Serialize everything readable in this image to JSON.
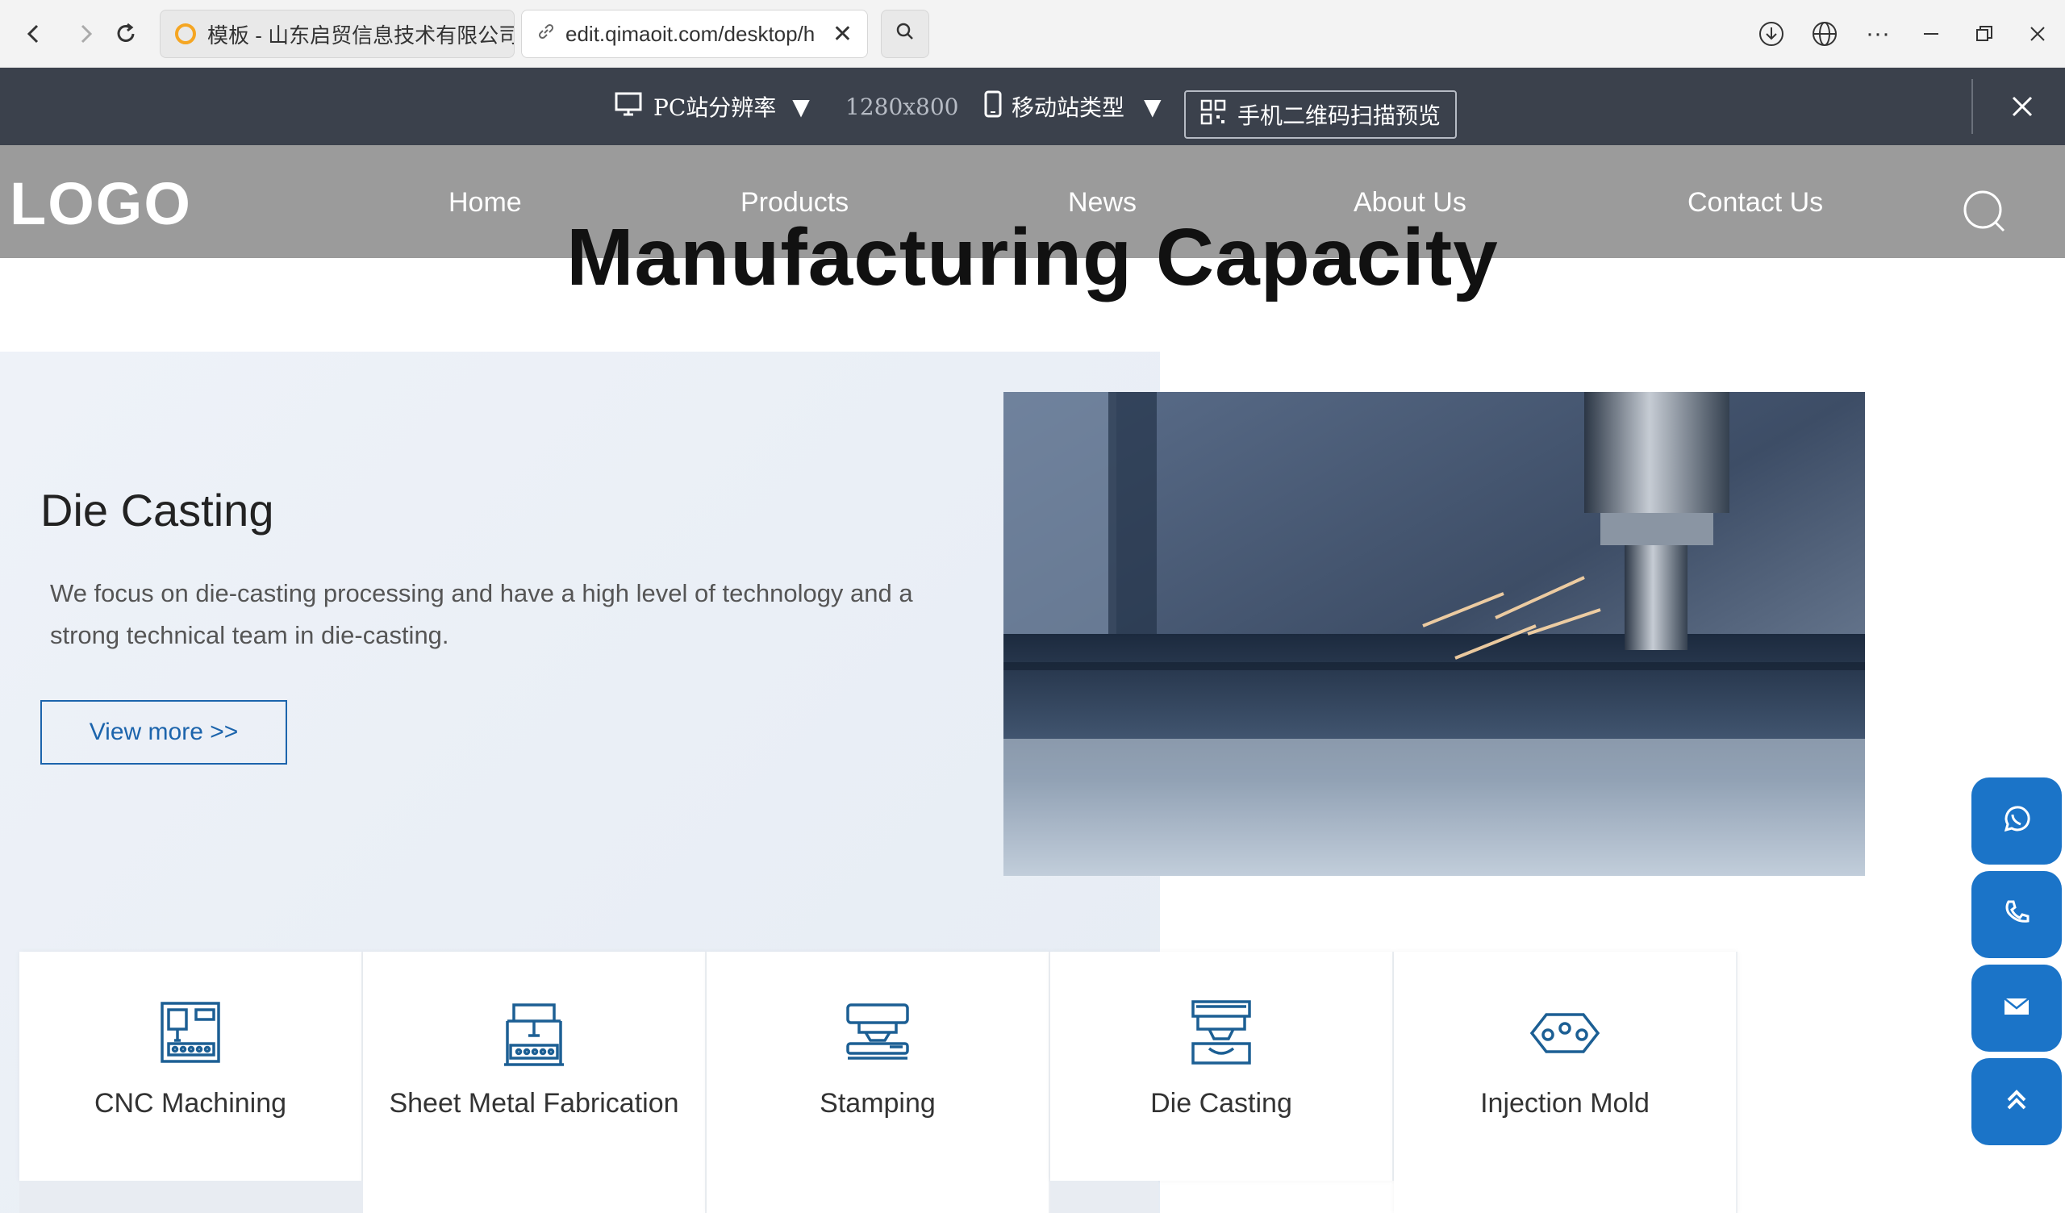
{
  "browser": {
    "tabs": [
      {
        "title": "模板 - 山东启贸信息技术有限公司",
        "active": false
      },
      {
        "title": "edit.qimaoit.com/desktop/h",
        "active": true
      }
    ]
  },
  "editor": {
    "pc_resolution_label": "PC站分辨率",
    "resolution_value": "1280x800",
    "mobile_type_label": "移动站类型",
    "qr_preview_label": "手机二维码扫描预览"
  },
  "site": {
    "logo": "LOGO",
    "menu": [
      "Home",
      "Products",
      "News",
      "About Us",
      "Contact Us"
    ]
  },
  "section": {
    "title": "Manufacturing Capacity"
  },
  "hero": {
    "title": "Die Casting",
    "description": "We focus on die-casting processing and have a high level of technology and a strong technical team in die-casting.",
    "button": "View more >>"
  },
  "cards": [
    {
      "label": "CNC Machining",
      "icon": "cnc-machine-icon"
    },
    {
      "label": "Sheet Metal Fabrication",
      "icon": "sheet-metal-icon"
    },
    {
      "label": "Stamping",
      "icon": "stamping-icon"
    },
    {
      "label": "Die Casting",
      "icon": "die-casting-icon"
    },
    {
      "label": "Injection Mold",
      "icon": "injection-mold-icon"
    }
  ],
  "floating_buttons": [
    "whatsapp-icon",
    "phone-icon",
    "mail-icon",
    "back-to-top-icon"
  ],
  "colors": {
    "accent": "#1b74c8",
    "header": "#9b9b9b",
    "editor_bar": "#3b414c",
    "icon": "#1c5f94"
  }
}
